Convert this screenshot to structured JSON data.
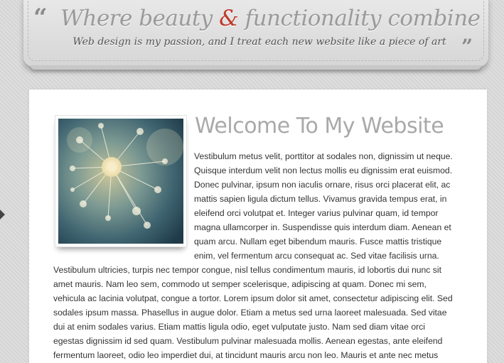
{
  "header": {
    "open_quote": "“",
    "close_quote": "”",
    "tagline_part1": "Where beauty ",
    "tagline_amp": "&",
    "tagline_part2": " functionality combine",
    "subtitle": "Web design is my passion, and I treat each new website like a piece of art"
  },
  "main": {
    "title": "Welcome To My Website",
    "image_subject": "dandelion-photo",
    "para_right_lines": [
      "Vestibulum metus velit, porttitor at sodales non, dignissim ut neque.",
      "Quisque interdum velit non lectus mollis eu dignissim erat euismod.",
      "Donec pulvinar, ipsum non iaculis ornare, risus orci placerat elit, ac",
      "mattis sapien ligula dictum tellus. Vivamus gravida tempus erat, in",
      "eleifend orci volutpat et. Integer varius pulvinar quam, id tempor",
      "magna ullamcorper in. Suspendisse quis interdum diam. Aenean et",
      "quam arcu. Nullam eget bibendum mauris. Fusce mattis tristique",
      "enim, vel fermentum arcu consequat ac. Sed vitae facilisis urna."
    ],
    "para_full_lines": [
      "Vestibulum ultricies, turpis nec tempor congue, nisl tellus condimentum mauris, id lobortis dui nunc sit",
      "amet mauris. Nam leo sem, commodo ut semper scelerisque, adipiscing at quam. Donec mi sem,",
      "vehicula ac lacinia volutpat, congue a tortor. Lorem ipsum dolor sit amet, consectetur adipiscing elit. Sed",
      "sodales ipsum massa. Phasellus in augue dolor. Etiam a metus sed urna laoreet malesuada. Sed vitae",
      "dui at enim sodales varius. Etiam mattis ligula odio, eget vulputate justo. Nam sed diam vitae orci",
      "egestas dignissim id sed quam. Vestibulum pulvinar malesuada mollis. Aenean egestas, ante eleifend",
      "fermentum laoreet, odio leo imperdiet dui, at tincidunt mauris arcu non leo. Mauris et ante nec metus"
    ]
  },
  "colors": {
    "accent": "#c0392b",
    "tagline": "#9a9a9a",
    "heading": "#a9a9a9",
    "body_text": "#333333"
  }
}
